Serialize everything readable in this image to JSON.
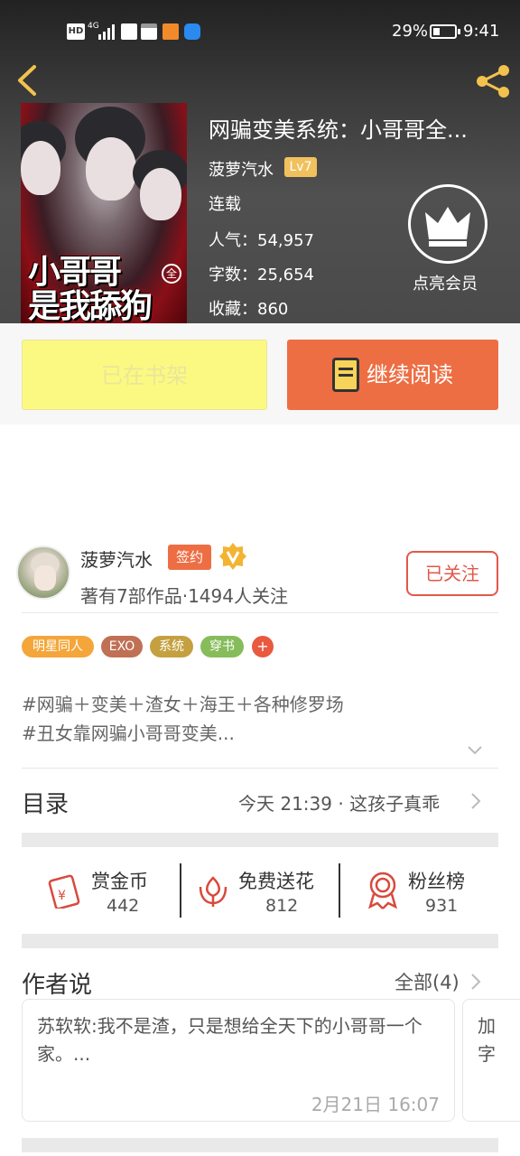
{
  "status_bar": {
    "signal_label": "4G",
    "battery": "29%",
    "time": "9:41"
  },
  "cover": {
    "title_line1": "小哥哥",
    "title_line2": "是我舔狗",
    "badge": "全"
  },
  "book": {
    "title": "网骗变美系统：小哥哥全...",
    "author": "菠萝汽水",
    "author_level": "Lv7",
    "status": "连载",
    "popularity": "人气：54,957",
    "word_count": "字数：25,654",
    "favorites": "收藏：860"
  },
  "vip": {
    "label": "点亮会员"
  },
  "actions": {
    "shelf_label": "已在书架",
    "read_label": "继续阅读"
  },
  "author_card": {
    "name": "菠萝汽水",
    "signed_label": "签约",
    "stats": "著有7部作品·1494人关注",
    "follow_label": "已关注"
  },
  "tags": [
    {
      "label": "明星同人",
      "color": "#f4a63b"
    },
    {
      "label": "EXO",
      "color": "#c07055"
    },
    {
      "label": "系统",
      "color": "#c5a040"
    },
    {
      "label": "穿书",
      "color": "#86bc5a"
    }
  ],
  "tag_plus": "+",
  "description": {
    "line1": "#网骗＋变美＋渣女＋海王＋各种修罗场",
    "line2": "#丑女靠网骗小哥哥变美..."
  },
  "toc": {
    "title": "目录",
    "latest": "今天 21:39 · 这孩子真乖"
  },
  "stats": [
    {
      "label": "赏金币",
      "value": "442",
      "icon": "red-envelope-icon"
    },
    {
      "label": "免费送花",
      "value": "812",
      "icon": "flower-icon"
    },
    {
      "label": "粉丝榜",
      "value": "931",
      "icon": "medal-icon"
    }
  ],
  "author_say": {
    "title": "作者说",
    "all_label": "全部(4)",
    "comment_text": "苏软软:我不是渣，只是想给全天下的小哥哥一个家。...",
    "comment_date": "2月21日  16:07",
    "comment2_text": "加字"
  },
  "colors": {
    "accent": "#ee6e44",
    "shelf_button": "#fbf982",
    "follow_red": "#e2584a",
    "level_gold": "#f1c15d"
  }
}
